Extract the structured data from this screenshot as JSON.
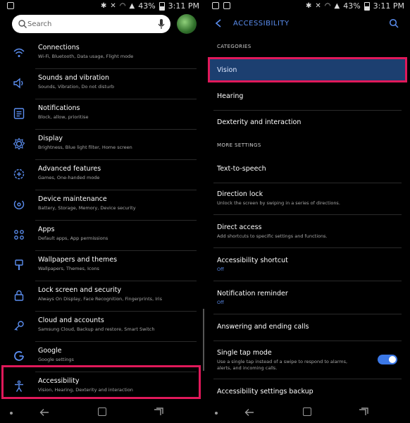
{
  "status_bar": {
    "time": "3:11 PM",
    "battery": "43%"
  },
  "left": {
    "search": {
      "placeholder": "Search"
    },
    "items": [
      {
        "title": "Connections",
        "sub": "Wi-Fi, Bluetooth, Data usage, Flight mode",
        "icon": "wifi-icon"
      },
      {
        "title": "Sounds and vibration",
        "sub": "Sounds, Vibration, Do not disturb",
        "icon": "speaker-icon"
      },
      {
        "title": "Notifications",
        "sub": "Block, allow, prioritise",
        "icon": "notifications-icon"
      },
      {
        "title": "Display",
        "sub": "Brightness, Blue light filter, Home screen",
        "icon": "brightness-icon"
      },
      {
        "title": "Advanced features",
        "sub": "Games, One-handed mode",
        "icon": "gear-plus-icon"
      },
      {
        "title": "Device maintenance",
        "sub": "Battery, Storage, Memory, Device security",
        "icon": "maintenance-icon"
      },
      {
        "title": "Apps",
        "sub": "Default apps, App permissions",
        "icon": "apps-grid-icon"
      },
      {
        "title": "Wallpapers and themes",
        "sub": "Wallpapers, Themes, Icons",
        "icon": "brush-icon"
      },
      {
        "title": "Lock screen and security",
        "sub": "Always On Display, Face Recognition, Fingerprints, Iris",
        "icon": "lock-icon"
      },
      {
        "title": "Cloud and accounts",
        "sub": "Samsung Cloud, Backup and restore, Smart Switch",
        "icon": "key-icon"
      },
      {
        "title": "Google",
        "sub": "Google settings",
        "icon": "google-icon"
      },
      {
        "title": "Accessibility",
        "sub": "Vision, Hearing, Dexterity and interaction",
        "icon": "accessibility-icon"
      }
    ]
  },
  "right": {
    "title": "ACCESSIBILITY",
    "categories_label": "CATEGORIES",
    "more_settings_label": "MORE SETTINGS",
    "vision": "Vision",
    "hearing": "Hearing",
    "dexterity": "Dexterity and interaction",
    "tts": "Text-to-speech",
    "direction_lock": {
      "title": "Direction lock",
      "sub": "Unlock the screen by swiping in a series of directions."
    },
    "direct_access": {
      "title": "Direct access",
      "sub": "Add shortcuts to specific settings and functions."
    },
    "shortcut": {
      "title": "Accessibility shortcut",
      "sub": "Off"
    },
    "reminder": {
      "title": "Notification reminder",
      "sub": "Off"
    },
    "answering": "Answering and ending calls",
    "single_tap": {
      "title": "Single tap mode",
      "sub1": "Use a single tap instead of a swipe to respond to alarms,",
      "sub2": "alerts, and incoming calls.",
      "enabled": true
    },
    "backup": "Accessibility settings backup"
  },
  "colors": {
    "accent": "#5b8ef0",
    "highlight": "#e0195a",
    "selected_row": "#1c3f70"
  }
}
